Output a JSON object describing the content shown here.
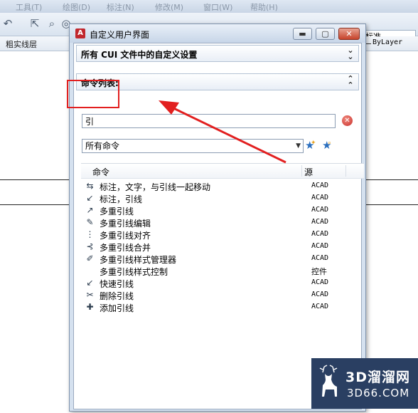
{
  "background_app": {
    "menu_items": [
      "工具(T)",
      "绘图(D)",
      "标注(N)",
      "修改(M)",
      "窗口(W)",
      "帮助(H)"
    ],
    "style_box_value": "标准",
    "layer_name": "粗实线层",
    "linetype_value": "ByLayer"
  },
  "dialog": {
    "title": "自定义用户界面",
    "minimize_symbol": "▬",
    "maximize_symbol": "▢",
    "close_symbol": "✕",
    "cui_section_title": "所有 CUI 文件中的自定义设置",
    "cui_section_chevron": "»",
    "commands_section_title": "命令列表:",
    "commands_section_chevron": "«",
    "search": {
      "value": "引",
      "clear_symbol": "✕"
    },
    "filter": {
      "selected": "所有命令",
      "arrow": "▼"
    },
    "new_command_icon": "★",
    "find_command_icon": "★",
    "columns": {
      "command": "命令",
      "source": "源"
    },
    "commands": [
      {
        "name": "标注，文字，与引线一起移动",
        "source": "ACAD",
        "icon": "⇆"
      },
      {
        "name": "标注，引线",
        "source": "ACAD",
        "icon": "↙"
      },
      {
        "name": "多重引线",
        "source": "ACAD",
        "icon": "↗"
      },
      {
        "name": "多重引线编辑",
        "source": "ACAD",
        "icon": "✎"
      },
      {
        "name": "多重引线对齐",
        "source": "ACAD",
        "icon": "⋮"
      },
      {
        "name": "多重引线合并",
        "source": "ACAD",
        "icon": "⊰"
      },
      {
        "name": "多重引线样式管理器",
        "source": "ACAD",
        "icon": "✐"
      },
      {
        "name": "多重引线样式控制",
        "source": "控件",
        "icon": ""
      },
      {
        "name": "快速引线",
        "source": "ACAD",
        "icon": "↙"
      },
      {
        "name": "删除引线",
        "source": "ACAD",
        "icon": "✂"
      },
      {
        "name": "添加引线",
        "source": "ACAD",
        "icon": "✚"
      }
    ]
  },
  "annotation": {
    "highlight_color": "#e21f1f"
  },
  "watermark": {
    "brand": "3D溜溜网",
    "url": "3D66.COM"
  }
}
